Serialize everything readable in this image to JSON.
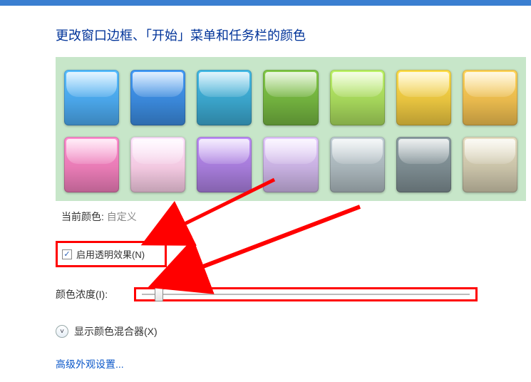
{
  "header": {
    "title": "更改窗口边框、「开始」菜单和任务栏的颜色"
  },
  "colors": {
    "row1": [
      "#4aa5e8",
      "#3a87d8",
      "#3aa3c9",
      "#71b03e",
      "#a4d45a",
      "#e6c23f",
      "#e8b94d"
    ],
    "row2": [
      "#e87bb5",
      "#f2c8e0",
      "#a57bd8",
      "#c7b0e0",
      "#a8b4b9",
      "#7b8a8f",
      "#c9c2a8"
    ]
  },
  "currentColor": {
    "label": "当前颜色:",
    "value": "自定义"
  },
  "transparency": {
    "checked": true,
    "mark": "✓",
    "label": "启用透明效果(N)"
  },
  "intensity": {
    "label": "颜色浓度(I):"
  },
  "mixer": {
    "icon": "˅",
    "label": "显示颜色混合器(X)"
  },
  "advanced": {
    "label": "高级外观设置..."
  }
}
